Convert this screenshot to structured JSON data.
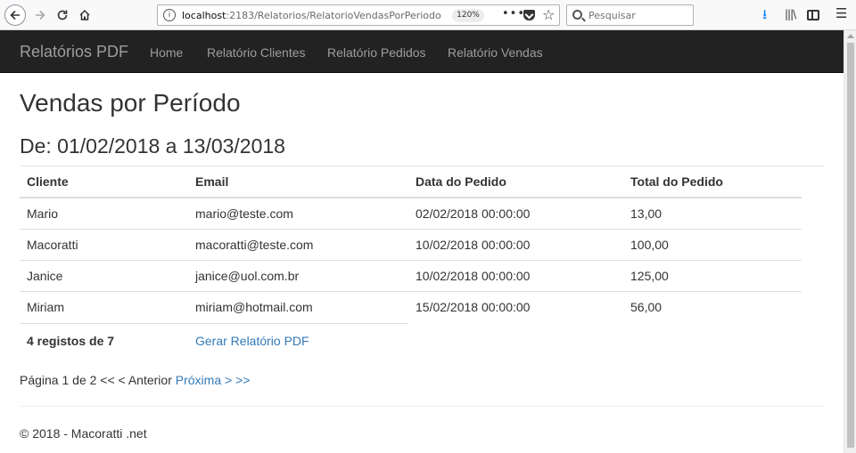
{
  "browser": {
    "url_host": "localhost",
    "url_path": ":2183/Relatorios/RelatorioVendasPorPeriodo",
    "zoom": "120%",
    "more": "•••",
    "search_placeholder": "Pesquisar",
    "icons": {
      "back": "arrow-left",
      "forward": "arrow-right",
      "reload": "reload",
      "home": "home",
      "info": "info",
      "pocket": "pocket",
      "bookmark": "star",
      "search": "search",
      "download": "download-arrow",
      "library": "library",
      "sidebar": "sidebar",
      "menu": "hamburger"
    }
  },
  "navbar": {
    "brand": "Relatórios PDF",
    "links": [
      "Home",
      "Relatório Clientes",
      "Relatório Pedidos",
      "Relatório Vendas"
    ]
  },
  "page": {
    "title": "Vendas por Período",
    "subtitle": "De: 01/02/2018 a 13/03/2018"
  },
  "table": {
    "headers": [
      "Cliente",
      "Email",
      "Data do Pedido",
      "Total do Pedido"
    ],
    "rows": [
      [
        "Mario",
        "mario@teste.com",
        "02/02/2018 00:00:00",
        "13,00"
      ],
      [
        "Macoratti",
        "macoratti@teste.com",
        "10/02/2018 00:00:00",
        "100,00"
      ],
      [
        "Janice",
        "janice@uol.com.br",
        "10/02/2018 00:00:00",
        "125,00"
      ],
      [
        "Miriam",
        "miriam@hotmail.com",
        "15/02/2018 00:00:00",
        "56,00"
      ]
    ],
    "count_text": "4 registos de 7",
    "pdf_link": "Gerar Relatório PDF"
  },
  "pager": {
    "info": "Página 1 de 2",
    "first": "<<",
    "prev": "< Anterior",
    "next": "Próxima >",
    "last": ">>"
  },
  "footer": "© 2018 - Macoratti .net",
  "colors": {
    "navbar_bg": "#222222",
    "nav_text": "#9d9d9d",
    "link": "#337ab7"
  }
}
